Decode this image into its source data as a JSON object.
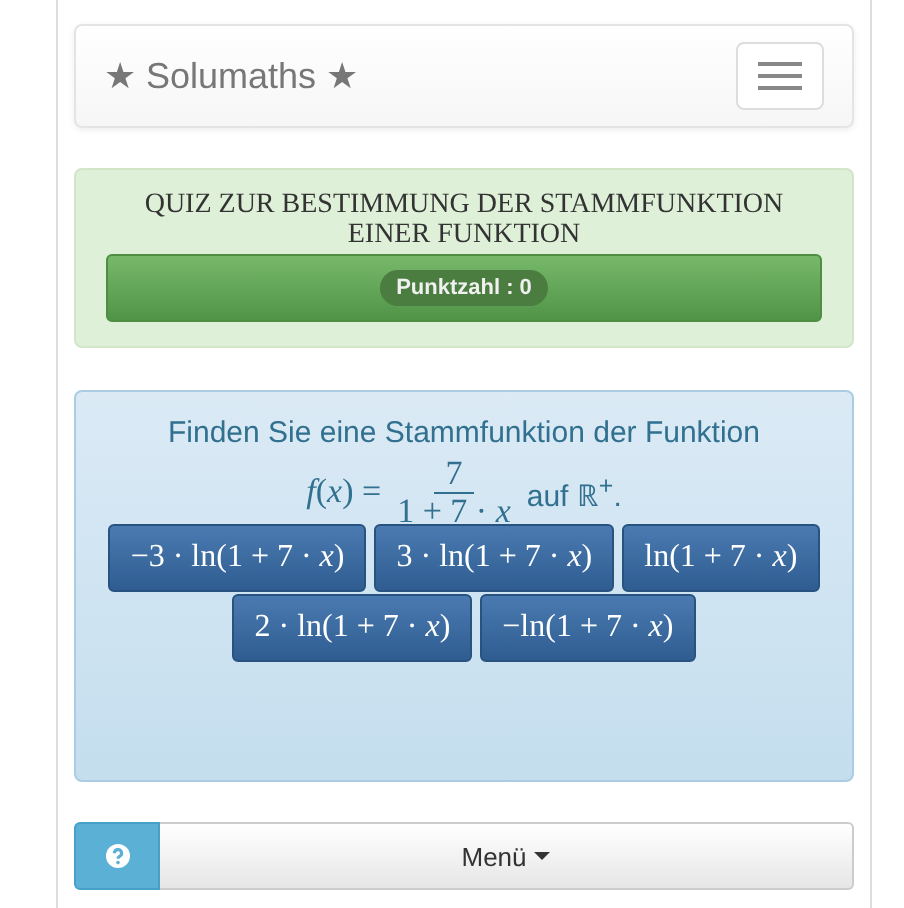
{
  "navbar": {
    "brand": "★ Solumaths ★"
  },
  "quiz": {
    "title": "QUIZ ZUR BESTIMMUNG DER STAMMFUNKTION EINER FUNKTION",
    "score": "Punktzahl : 0"
  },
  "question": {
    "prompt": "Finden Sie eine Stammfunktion der Funktion",
    "lhs": "*f*(*x*) =",
    "numerator": "7",
    "denominator": "1 + 7 · *x*",
    "suffix": "auf ℝ$^{+}$."
  },
  "answers": [
    {
      "text": "−3 · ln(1 + 7 · *x*)"
    },
    {
      "text": "3 · ln(1 + 7 · *x*)"
    },
    {
      "text": "ln(1 + 7 · *x*)"
    },
    {
      "text": "2 · ln(1 + 7 · *x*)"
    },
    {
      "text": "−ln(1 + 7 · *x*)"
    }
  ],
  "footer": {
    "menu": "Menü"
  }
}
